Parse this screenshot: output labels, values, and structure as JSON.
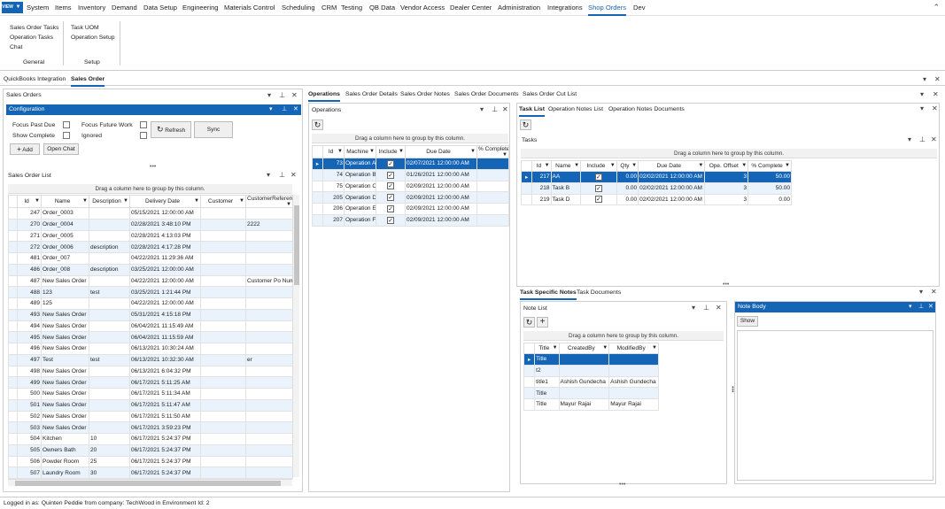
{
  "menu": {
    "items": [
      "System",
      "Items",
      "Inventory",
      "Demand",
      "Data Setup",
      "Engineering",
      "Materials Control",
      "Scheduling",
      "CRM",
      "Testing",
      "QB Data",
      "Vendor Access",
      "Dealer Center",
      "Administration",
      "Integrations",
      "Shop Orders",
      "Dev"
    ],
    "active": "Shop Orders",
    "app_icon_text": "VIEW"
  },
  "ribbon": {
    "general": {
      "items": [
        "Sales Order Tasks",
        "Operation Tasks",
        "Chat"
      ],
      "label": "General"
    },
    "setup": {
      "items": [
        "Task UOM",
        "Operation Setup"
      ],
      "label": "Setup"
    }
  },
  "doc_tabs": [
    "QuickBooks Integration",
    "Sales Order"
  ],
  "sales_orders": {
    "title": "Sales Orders",
    "config_title": "Configuration",
    "focus_past_due": "Focus Past Due",
    "show_complete": "Show Complete",
    "focus_future_work": "Focus Future Work",
    "ignored": "Ignored",
    "refresh": "Refresh",
    "sync": "Sync",
    "add": "Add",
    "open_chat": "Open Chat",
    "list_title": "Sales Order List",
    "group_hint": "Drag a column here to group by this column.",
    "columns": [
      "Id",
      "Name",
      "Description",
      "Delivery Date",
      "Customer",
      "CustomerReference"
    ],
    "rows": [
      [
        "247",
        "Order_0003",
        "",
        "05/15/2021 12:00:00 AM",
        "",
        ""
      ],
      [
        "270",
        "Order_0004",
        "",
        "02/28/2021 3:48:10 PM",
        "",
        "2222"
      ],
      [
        "271",
        "Order_0005",
        "",
        "02/28/2021 4:13:03 PM",
        "",
        ""
      ],
      [
        "272",
        "Order_0006",
        "description",
        "02/28/2021 4:17:28 PM",
        "",
        ""
      ],
      [
        "481",
        "Order_007",
        "",
        "04/22/2021 11:29:36 AM",
        "",
        ""
      ],
      [
        "486",
        "Order_008",
        "description",
        "03/25/2021 12:00:00 AM",
        "",
        ""
      ],
      [
        "487",
        "New Sales Order",
        "",
        "04/22/2021 12:00:00 AM",
        "",
        "Customer Po Num"
      ],
      [
        "488",
        "123",
        "test",
        "03/25/2021 1:21:44 PM",
        "",
        ""
      ],
      [
        "489",
        "125",
        "",
        "04/22/2021 12:00:00 AM",
        "",
        ""
      ],
      [
        "493",
        "New Sales Order",
        "",
        "05/31/2021 4:15:18 PM",
        "",
        ""
      ],
      [
        "494",
        "New Sales Order",
        "",
        "06/04/2021 11:15:49 AM",
        "",
        ""
      ],
      [
        "495",
        "New Sales Order",
        "",
        "06/04/2021 11:15:59 AM",
        "",
        ""
      ],
      [
        "496",
        "New Sales Order",
        "",
        "06/13/2021 10:30:24 AM",
        "",
        ""
      ],
      [
        "497",
        "Test",
        "test",
        "06/13/2021 10:32:30 AM",
        "",
        "er"
      ],
      [
        "498",
        "New Sales Order",
        "",
        "06/13/2021 6:04:32 PM",
        "",
        ""
      ],
      [
        "499",
        "New Sales Order",
        "",
        "06/17/2021 5:11:25 AM",
        "",
        ""
      ],
      [
        "500",
        "New Sales Order",
        "",
        "06/17/2021 5:11:34 AM",
        "",
        ""
      ],
      [
        "501",
        "New Sales Order",
        "",
        "06/17/2021 5:11:47 AM",
        "",
        ""
      ],
      [
        "502",
        "New Sales Order",
        "",
        "06/17/2021 5:11:50 AM",
        "",
        ""
      ],
      [
        "503",
        "New Sales Order",
        "",
        "06/17/2021 3:59:23 PM",
        "",
        ""
      ],
      [
        "504",
        "Kitchen",
        "10",
        "06/17/2021 5:24:37 PM",
        "",
        ""
      ],
      [
        "505",
        "Owners Bath",
        "20",
        "06/17/2021 5:24:37 PM",
        "",
        ""
      ],
      [
        "506",
        "Powder Room",
        "25",
        "06/17/2021 5:24:37 PM",
        "",
        ""
      ],
      [
        "507",
        "Laundry Room",
        "30",
        "06/17/2021 5:24:37 PM",
        "",
        ""
      ]
    ]
  },
  "center_tabs": [
    "Operations",
    "Sales Order Details",
    "Sales Order Notes",
    "Sales Order Documents",
    "Sales Order Cut List"
  ],
  "operations": {
    "title": "Operations",
    "group_hint": "Drag a column here to group by this column.",
    "columns": [
      "Id",
      "Machine",
      "Include",
      "Due Date",
      "% Complete"
    ],
    "rows": [
      [
        "73",
        "Operation A",
        "true",
        "02/07/2021 12:00:00 AM",
        ""
      ],
      [
        "74",
        "Operation B",
        "true",
        "01/26/2021 12:00:00 AM",
        ""
      ],
      [
        "75",
        "Operation C",
        "true",
        "02/09/2021 12:00:00 AM",
        ""
      ],
      [
        "205",
        "Operation D",
        "true",
        "02/09/2021 12:00:00 AM",
        ""
      ],
      [
        "206",
        "Operation E",
        "true",
        "02/09/2021 12:00:00 AM",
        ""
      ],
      [
        "207",
        "Operation F",
        "true",
        "02/09/2021 12:00:00 AM",
        ""
      ]
    ]
  },
  "right_tabs": [
    "Task List",
    "Operation Notes List",
    "Operation Notes Documents"
  ],
  "tasks": {
    "title": "Tasks",
    "group_hint": "Drag a column here to group by this column.",
    "columns": [
      "Id",
      "Name",
      "Include",
      "Qty",
      "Due Date",
      "Ope. Offset",
      "% Complete"
    ],
    "rows": [
      [
        "217",
        "AA",
        "true",
        "0.00",
        "02/02/2021 12:00:00 AM",
        "3",
        "50.00"
      ],
      [
        "218",
        "Task B",
        "true",
        "0.00",
        "02/02/2021 12:00:00 AM",
        "3",
        "50.00"
      ],
      [
        "219",
        "Task D",
        "true",
        "0.00",
        "02/02/2021 12:00:00 AM",
        "3",
        "0.00"
      ]
    ]
  },
  "notes_tabs": [
    "Task Specific Notes",
    "Task Documents"
  ],
  "note_list": {
    "title": "Note List",
    "group_hint": "Drag a column here to group by this column.",
    "columns": [
      "Title",
      "CreatedBy",
      "ModifiedBy"
    ],
    "rows": [
      [
        "Title",
        "",
        ""
      ],
      [
        "t2",
        "",
        ""
      ],
      [
        "title1",
        "Ashish Gundecha",
        "Ashish Gundecha"
      ],
      [
        "Title",
        "",
        ""
      ],
      [
        "Title",
        "Mayur Rajai",
        "Mayur Rajai"
      ]
    ]
  },
  "note_body": {
    "title": "Note Body",
    "show": "Show"
  },
  "status": "Logged in as: Quinten Peddie  from company: TechWood in Environment Id: 2",
  "colors": {
    "accent": "#1565b6",
    "row_alt": "#eaf3fb"
  }
}
